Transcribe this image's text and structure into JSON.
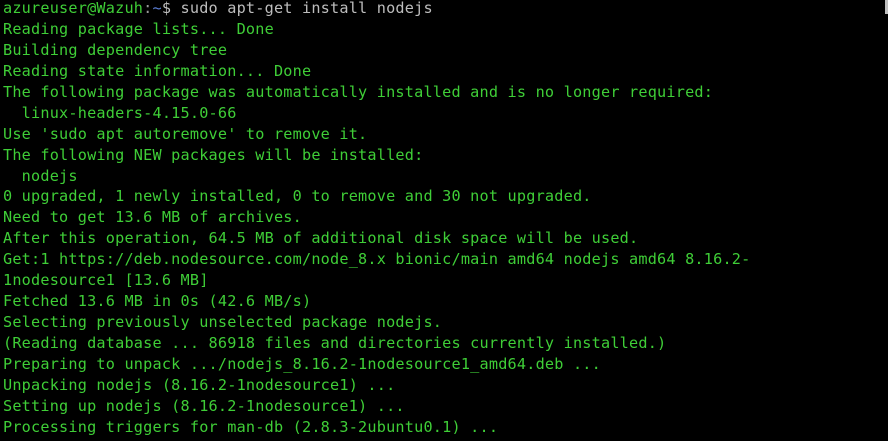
{
  "prompt": {
    "user_host": "azureuser@Wazuh",
    "separator": ":",
    "path": "~",
    "symbol": "$",
    "command": " sudo apt-get install nodejs"
  },
  "output_lines": [
    "Reading package lists... Done",
    "Building dependency tree",
    "Reading state information... Done",
    "The following package was automatically installed and is no longer required:",
    "  linux-headers-4.15.0-66",
    "Use 'sudo apt autoremove' to remove it.",
    "The following NEW packages will be installed:",
    "  nodejs",
    "0 upgraded, 1 newly installed, 0 to remove and 30 not upgraded.",
    "Need to get 13.6 MB of archives.",
    "After this operation, 64.5 MB of additional disk space will be used.",
    "Get:1 https://deb.nodesource.com/node_8.x bionic/main amd64 nodejs amd64 8.16.2-",
    "1nodesource1 [13.6 MB]",
    "Fetched 13.6 MB in 0s (42.6 MB/s)",
    "Selecting previously unselected package nodejs.",
    "(Reading database ... 86918 files and directories currently installed.)",
    "Preparing to unpack .../nodejs_8.16.2-1nodesource1_amd64.deb ...",
    "Unpacking nodejs (8.16.2-1nodesource1) ...",
    "Setting up nodejs (8.16.2-1nodesource1) ...",
    "Processing triggers for man-db (2.8.3-2ubuntu0.1) ..."
  ],
  "colors": {
    "background": "#000000",
    "text_green": "#3fce37",
    "prompt_path_blue": "#5c7fd6",
    "command_gray": "#bdbdbd"
  }
}
